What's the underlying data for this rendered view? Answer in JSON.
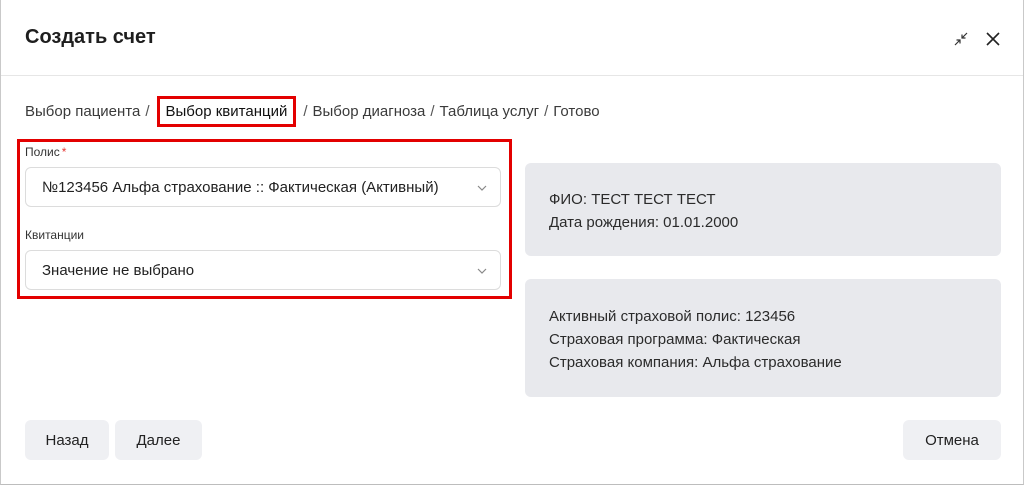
{
  "dialog": {
    "title": "Создать счет"
  },
  "steps": {
    "s1": "Выбор пациента",
    "s2": "Выбор квитанций",
    "s3": "Выбор диагноза",
    "s4": "Таблица услуг",
    "s5": "Готово",
    "separator": "/"
  },
  "form": {
    "policy_label": "Полис",
    "required_mark": "*",
    "policy_value": "№123456 Альфа страхование :: Фактическая (Активный)",
    "receipts_label": "Квитанции",
    "receipts_value": "Значение не выбрано"
  },
  "patient_info": {
    "name_line": "ФИО: ТЕСТ ТЕСТ ТЕСТ",
    "birth_line": "Дата рождения: 01.01.2000"
  },
  "policy_info": {
    "policy_line": "Активный страховой полис: 123456",
    "program_line": "Страховая программа: Фактическая",
    "company_line": "Страховая компания: Альфа страхование"
  },
  "buttons": {
    "back": "Назад",
    "next": "Далее",
    "cancel": "Отмена"
  },
  "icons": {
    "collapse": "collapse-arrows-icon",
    "close": "close-icon",
    "chevron": "chevron-down-icon"
  },
  "colors": {
    "highlight": "#e30000",
    "info_panel": "#e8e9ed",
    "button_bg": "#eff0f3",
    "required": "#e53935"
  }
}
